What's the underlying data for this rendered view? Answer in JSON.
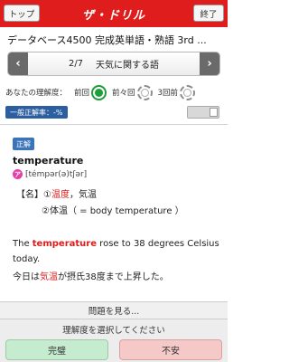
{
  "topbar": {
    "left_button": "トップ",
    "logo": "ザ・ドリル",
    "right_button": "終了",
    "accent": "#df1d1d"
  },
  "deck": {
    "title": "データベース4500 完成英単語・熟語 3rd ..."
  },
  "nav": {
    "prev": "‹",
    "next": "›",
    "counter": "2/7",
    "section": "天気に関する語"
  },
  "understanding": {
    "label": "あなたの理解度：",
    "items": [
      {
        "label": "前回",
        "state": "green"
      },
      {
        "label": "前々回",
        "state": "empty"
      },
      {
        "label": "3回前",
        "state": "empty"
      }
    ]
  },
  "accuracy": {
    "label": "一般正解率：-%"
  },
  "card": {
    "correct_tag": "正解",
    "word": "temperature",
    "pron_icon": "ア",
    "pronunciation": "[témpər(ə)tʃər]",
    "meaning1_prefix": "【名】①",
    "meaning1_highlight": "温度",
    "meaning1_suffix": "，気温",
    "meaning2": "②体温（ = body temperature ）",
    "example_en_before": "The ",
    "example_en_highlight": "temperature",
    "example_en_after": " rose to 38 degrees Celsius today.",
    "example_ja_before": "今日は",
    "example_ja_highlight": "気温",
    "example_ja_after": "が摂氏38度まで上昇した。"
  },
  "question_button": "問題を見る...",
  "bottom": {
    "prompt": "理解度を選択してください",
    "done": "完璧",
    "unsure": "不安"
  }
}
